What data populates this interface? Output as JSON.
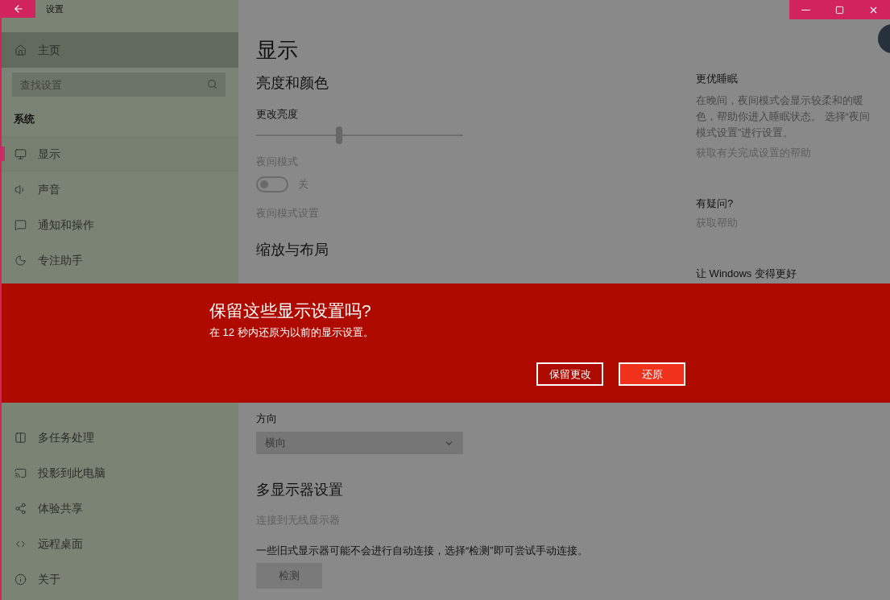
{
  "window": {
    "title": "设置"
  },
  "sidebar": {
    "home": "主页",
    "search": {
      "placeholder": "查找设置"
    },
    "section": "系统",
    "items": [
      {
        "label": "显示",
        "kind": "monitor",
        "selected": true
      },
      {
        "label": "声音",
        "kind": "speaker",
        "selected": false
      },
      {
        "label": "通知和操作",
        "kind": "message",
        "selected": false
      },
      {
        "label": "专注助手",
        "kind": "moon",
        "selected": false
      }
    ],
    "items_below": [
      {
        "label": "多任务处理",
        "kind": "multitask",
        "selected": false
      },
      {
        "label": "投影到此电脑",
        "kind": "project",
        "selected": false
      },
      {
        "label": "体验共享",
        "kind": "share",
        "selected": false
      },
      {
        "label": "远程桌面",
        "kind": "remote",
        "selected": false
      },
      {
        "label": "关于",
        "kind": "info",
        "selected": false
      }
    ]
  },
  "page": {
    "title": "显示"
  },
  "brightness": {
    "heading": "亮度和颜色",
    "label": "更改亮度",
    "level": 0.4
  },
  "night_mode": {
    "label": "夜间模式",
    "on": false,
    "state": "关",
    "disabled": true,
    "settings_link": "夜间模式设置"
  },
  "scale": {
    "heading": "缩放与布局"
  },
  "orientation": {
    "label": "方向",
    "value": "横向",
    "disabled": true
  },
  "multi_display": {
    "heading": "多显示器设置",
    "link": "连接到无线显示器",
    "description": "一些旧式显示器可能不会进行自动连接，选择“检测”即可尝试手动连接。",
    "button": {
      "label": "检测",
      "disabled": true
    }
  },
  "side_panel": [
    {
      "heading": "更优睡眠",
      "text": "在晚间，夜间模式会显示较柔和的暖色，帮助你进入睡眠状态。 选择“夜间模式设置”进行设置。",
      "link": "获取有关完成设置的帮助"
    },
    {
      "heading": "有疑问?",
      "link": "获取帮助"
    },
    {
      "heading": "让 Windows 变得更好"
    }
  ],
  "dialog": {
    "title": "保留这些显示设置吗?",
    "message": "在 12 秒内还原为以前的显示设置。",
    "buttons": [
      {
        "label": "保留更改",
        "primary": false
      },
      {
        "label": "还原",
        "primary": true
      }
    ]
  }
}
